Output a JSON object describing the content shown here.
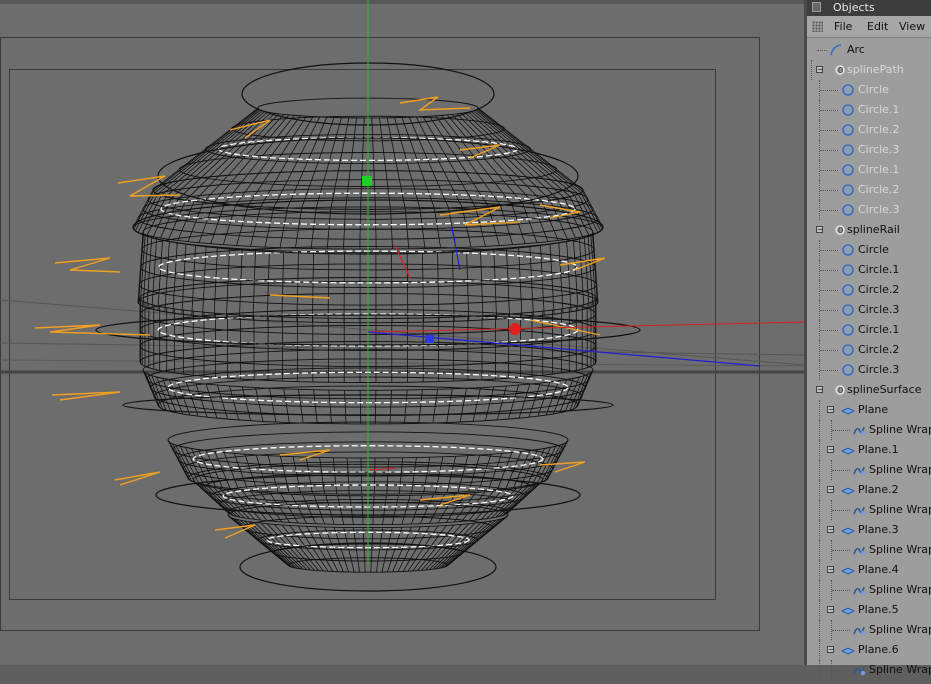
{
  "panel": {
    "title": "Objects",
    "menu": {
      "file": "File",
      "edit": "Edit",
      "view": "View"
    }
  },
  "tree": {
    "arc": "Arc",
    "spline_path": {
      "label": "splinePath",
      "children": [
        "Circle",
        "Circle.1",
        "Circle.2",
        "Circle.3",
        "Circle.1",
        "Circle.2",
        "Circle.3"
      ]
    },
    "spline_rail": {
      "label": "splineRail",
      "children": [
        "Circle",
        "Circle.1",
        "Circle.2",
        "Circle.3",
        "Circle.1",
        "Circle.2",
        "Circle.3"
      ]
    },
    "spline_surface": {
      "label": "splineSurface",
      "planes": [
        "Plane",
        "Plane.1",
        "Plane.2",
        "Plane.3",
        "Plane.4",
        "Plane.5",
        "Plane.6"
      ],
      "child_label": "Spline Wrap"
    }
  },
  "colors": {
    "viewport_bg": "#6d6d6d",
    "panel_bg": "#9d9d9d",
    "axis_x": "#d42020",
    "axis_y": "#20c020",
    "axis_z": "#2020d0",
    "spline_orange": "#f0a020",
    "circle_icon": "#3a6fbf"
  },
  "icons": {
    "arc": "arc-spline-icon",
    "null": "null-object-icon",
    "circle": "circle-spline-icon",
    "plane": "plane-object-icon",
    "wrap": "spline-wrap-icon"
  }
}
